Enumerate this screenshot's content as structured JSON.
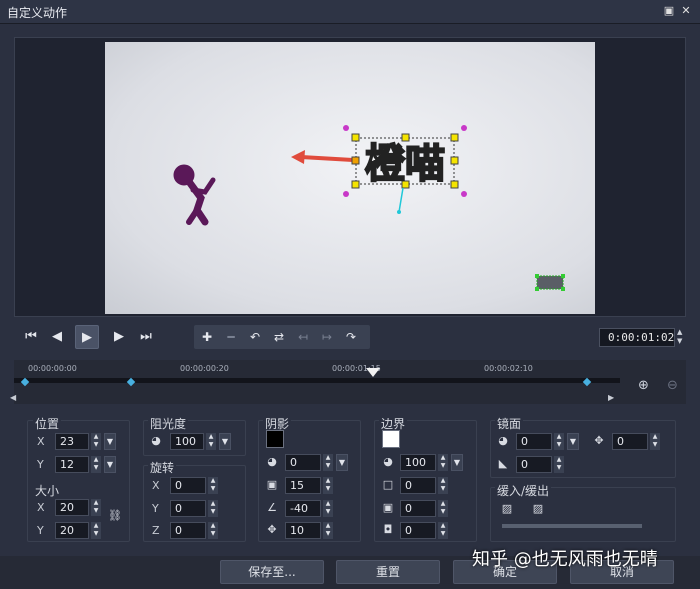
{
  "window": {
    "title": "自定义动作",
    "restore_icon": "restore-icon",
    "close_icon": "close-icon"
  },
  "canvas": {
    "text": "橙喵"
  },
  "playback": {
    "timecode": "0:00:01:02"
  },
  "timeline": {
    "marks": [
      "00:00:00:00",
      "00:00:00:20",
      "00:00:01:15",
      "00:00:02:10"
    ]
  },
  "position": {
    "title": "位置",
    "x_label": "X",
    "x": "23",
    "y_label": "Y",
    "y": "12"
  },
  "size": {
    "title": "大小",
    "x_label": "X",
    "x": "20",
    "y_label": "Y",
    "y": "20"
  },
  "opacity": {
    "title": "阻光度",
    "value": "100"
  },
  "rotation": {
    "title": "旋转",
    "x_label": "X",
    "x": "0",
    "y_label": "Y",
    "y": "0",
    "z_label": "Z",
    "z": "0"
  },
  "shadow": {
    "title": "阴影",
    "color": "#000000",
    "opacity": "0",
    "blur": "15",
    "angle": "-40",
    "distance": "10"
  },
  "border": {
    "title": "边界",
    "color": "#ffffff",
    "opacity": "100",
    "v1": "0",
    "v2": "0",
    "v3": "0"
  },
  "mirror": {
    "title": "镜面",
    "v1": "0",
    "v2": "0",
    "v3": "0"
  },
  "ease": {
    "title": "缓入/缓出"
  },
  "buttons": {
    "save_to": "保存至...",
    "reset": "重置",
    "ok": "确定",
    "cancel": "取消"
  },
  "watermark": {
    "text": "知乎 @也无风雨也无晴"
  }
}
